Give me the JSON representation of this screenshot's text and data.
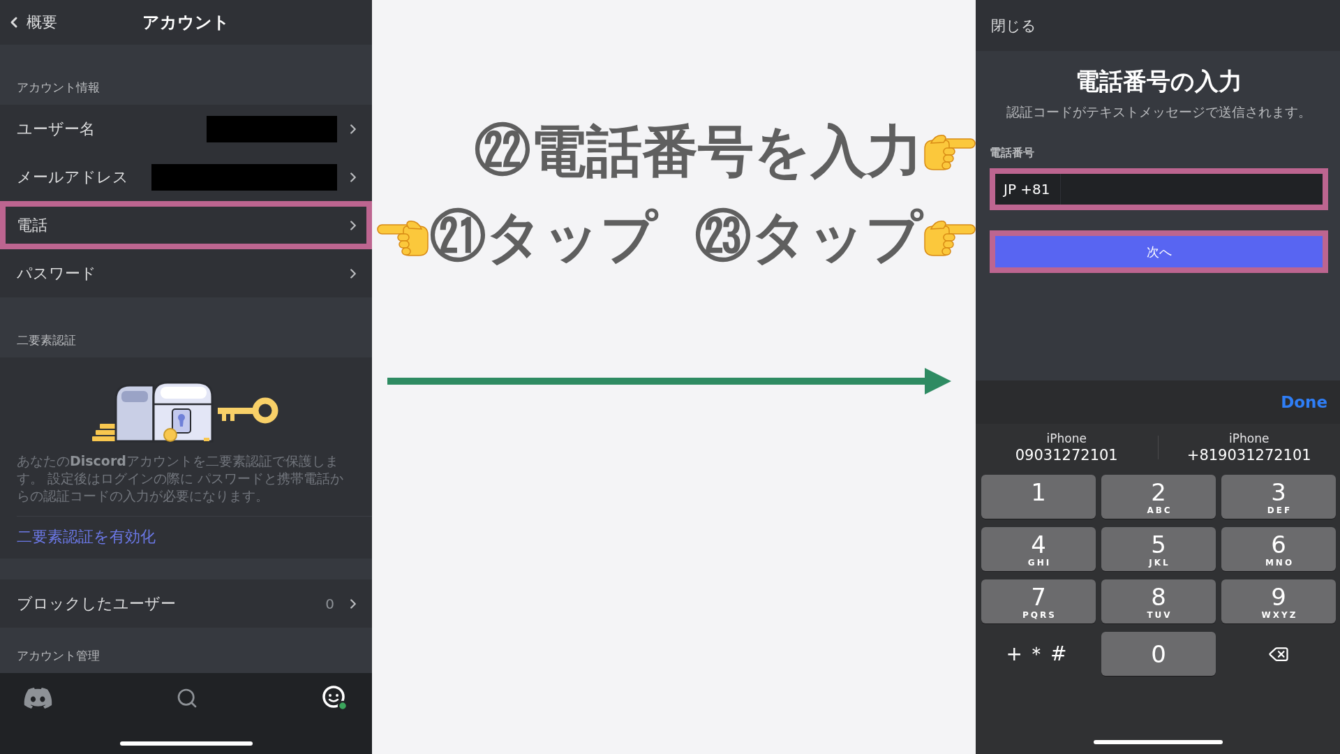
{
  "account_screen": {
    "back_label": "概要",
    "title": "アカウント",
    "sections": [
      {
        "kind": "list",
        "title": "アカウント情報",
        "rows": [
          {
            "label": "ユーザー名",
            "redacted": true,
            "highlighted": false
          },
          {
            "label": "メールアドレス",
            "redacted": true,
            "highlighted": false
          },
          {
            "label": "電話",
            "redacted": false,
            "highlighted": true
          },
          {
            "label": "パスワード",
            "redacted": false,
            "highlighted": false
          }
        ]
      },
      {
        "kind": "promo",
        "title": "二要素認証",
        "description": "あなたの**Discord**アカウントを二要素認証で保護します。 設定後はログインの際に パスワードと携帯電話からの認証コードの入力が必要になります。",
        "link": "二要素認証を有効化"
      },
      {
        "kind": "list",
        "rows": [
          {
            "label": "ブロックしたユーザー",
            "count": "0",
            "redacted": false,
            "highlighted": false
          }
        ]
      },
      {
        "kind": "heading",
        "title": "アカウント管理"
      }
    ],
    "tab_bar": [
      {
        "kind": "home",
        "selected": false
      },
      {
        "kind": "search",
        "selected": false
      },
      {
        "kind": "profile",
        "selected": true
      }
    ]
  },
  "callouts": [
    {
      "kind": "hand_right",
      "text": "㉒電話番号を入力"
    },
    {
      "kind": "hand_left",
      "text": "㉑タップ"
    },
    {
      "kind": "hand_right",
      "text": "㉓タップ"
    }
  ],
  "phone_screen": {
    "close_label": "閉じる",
    "title": "電話番号の入力",
    "subtitle": "認証コードがテキストメッセージで送信されます。",
    "field_label": "電話番号",
    "phone_field": {
      "country_code": "JP +81",
      "highlighted": true
    },
    "next_button": {
      "label": "次へ",
      "highlighted": true
    }
  },
  "keyboard": {
    "done_label": "Done",
    "suggestions": [
      {
        "label": "iPhone",
        "number": "09031272101"
      },
      {
        "label": "iPhone",
        "number": "+819031272101"
      }
    ],
    "keys": [
      {
        "kind": "digit",
        "digit": "1"
      },
      {
        "kind": "digit",
        "digit": "2",
        "letters": "ABC"
      },
      {
        "kind": "digit",
        "digit": "3",
        "letters": "DEF"
      },
      {
        "kind": "digit",
        "digit": "4",
        "letters": "GHI"
      },
      {
        "kind": "digit",
        "digit": "5",
        "letters": "JKL"
      },
      {
        "kind": "digit",
        "digit": "6",
        "letters": "MNO"
      },
      {
        "kind": "digit",
        "digit": "7",
        "letters": "PQRS"
      },
      {
        "kind": "digit",
        "digit": "8",
        "letters": "TUV"
      },
      {
        "kind": "digit",
        "digit": "9",
        "letters": "WXYZ"
      },
      {
        "kind": "symbols",
        "label": "+＊#"
      },
      {
        "kind": "digit",
        "digit": "0"
      },
      {
        "kind": "backspace"
      }
    ]
  }
}
